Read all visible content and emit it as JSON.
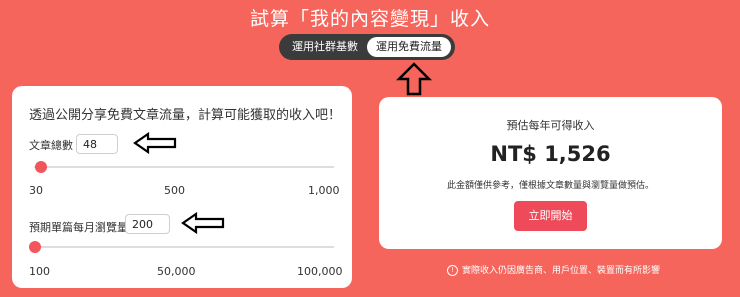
{
  "header": {
    "title": "試算「我的內容變現」收入"
  },
  "toggle": {
    "options": [
      "運用社群基數",
      "運用免費流量"
    ],
    "selected": "運用免費流量"
  },
  "calculator": {
    "intro": "透過公開分享免費文章流量，計算可能獲取的收入吧！",
    "articles": {
      "label": "文章總數",
      "value": "48",
      "min_label": "30",
      "mid_label": "500",
      "max_label": "1,000",
      "min": 30,
      "max": 1000
    },
    "views": {
      "label": "預期單篇每月瀏覽量",
      "value": "200",
      "min_label": "100",
      "mid_label": "50,000",
      "max_label": "100,000",
      "min": 100,
      "max": 100000
    }
  },
  "result": {
    "label": "預估每年可得收入",
    "amount": "NT$ 1,526",
    "note": "此金額僅供參考，僅根據文章數量與瀏覽量做預估。",
    "cta": "立即開始"
  },
  "footnote": "實際收入仍因廣告商、用戶位置、裝置而有所影響",
  "colors": {
    "background": "#f6655b",
    "accent": "#ef4a5a",
    "toggle_bg": "#3b3b3b"
  }
}
